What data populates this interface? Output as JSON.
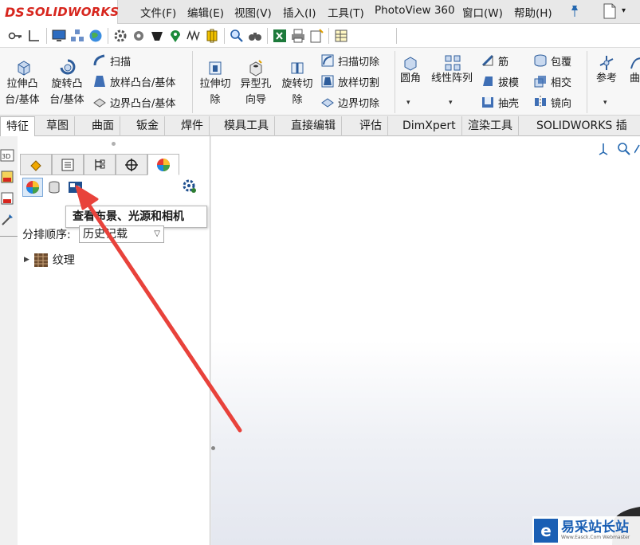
{
  "app": {
    "logo_ds": "DS",
    "logo_text": "SOLIDWORKS"
  },
  "menu": [
    "文件(F)",
    "编辑(E)",
    "视图(V)",
    "插入(I)",
    "工具(T)",
    "PhotoView 360",
    "窗口(W)",
    "帮助(H)"
  ],
  "commands": {
    "extrude_boss": "拉伸凸\n台/基体",
    "revolve_boss": "旋转凸\n台/基体",
    "sweep": "扫描",
    "loft_boss": "放样凸台/基体",
    "boundary_boss": "边界凸台/基体",
    "extrude_cut": "拉伸切\n除",
    "hole_wizard": "异型孔\n向导",
    "revolve_cut": "旋转切\n除",
    "sweep_cut": "扫描切除",
    "loft_cut": "放样切割",
    "boundary_cut": "边界切除",
    "fillet": "圆角",
    "linear_pattern": "线性阵列",
    "rib": "筋",
    "draft": "拔模",
    "shell": "抽壳",
    "wrap": "包覆",
    "intersect": "相交",
    "mirror": "镜向",
    "reference": "参考",
    "curves": "曲"
  },
  "tabs": [
    "特征",
    "草图",
    "曲面",
    "钣金",
    "焊件",
    "模具工具",
    "直接编辑",
    "评估",
    "DimXpert",
    "渲染工具",
    "SOLIDWORKS 插件"
  ],
  "active_tab": "特征",
  "panel": {
    "tooltip": "查看布景、光源和相机",
    "sort_label": "分排顺序:",
    "sort_value": "历史记载",
    "tree_item": "纹理"
  },
  "watermark": {
    "badge": "e",
    "text": "易采站长站",
    "sub": "Www.Easck.Com Webmaster"
  },
  "colors": {
    "brand_red": "#d7261e",
    "arrow_red": "#e8423b",
    "watermark_blue": "#1a5fb4"
  },
  "icons": [
    "sweep-icon",
    "loft-icon",
    "boundary-icon",
    "fillet-icon",
    "linear-pattern-icon",
    "rib-icon",
    "draft-icon",
    "shell-icon",
    "wrap-icon",
    "intersect-icon",
    "mirror-icon",
    "appearance-icon",
    "scene-icon",
    "camera-icon"
  ]
}
